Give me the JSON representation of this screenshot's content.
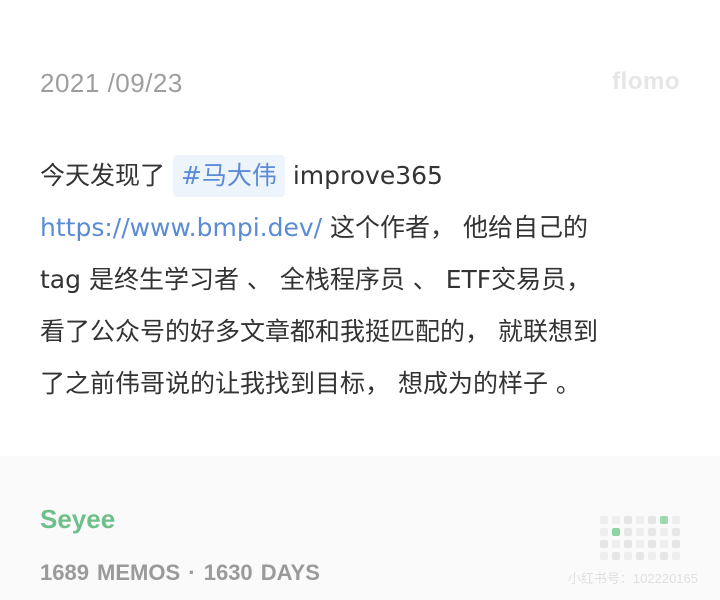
{
  "header": {
    "date": "2021 /09/23",
    "brand": "flomo"
  },
  "memo": {
    "line1_prefix": "今天发现了 ",
    "tag": "#马大伟",
    "line1_suffix": " improve365",
    "link": "https://www.bmpi.dev/",
    "line2_suffix": " 这个作者， 他给自己的",
    "line3": "tag 是终生学习者 、 全栈程序员 、 ETF交易员，",
    "line4": "看了公众号的好多文章都和我挺匹配的， 就联想到",
    "line5": "了之前伟哥说的让我找到目标， 想成为的样子 。"
  },
  "footer": {
    "author": "Seyee",
    "stats": "1689 MEMOS · 1630 DAYS",
    "watermark": "小红书号：102220165"
  },
  "colors": {
    "accent_green": "#6fbf8a",
    "link_blue": "#5b8bd6",
    "tag_bg": "#eef4fc"
  }
}
